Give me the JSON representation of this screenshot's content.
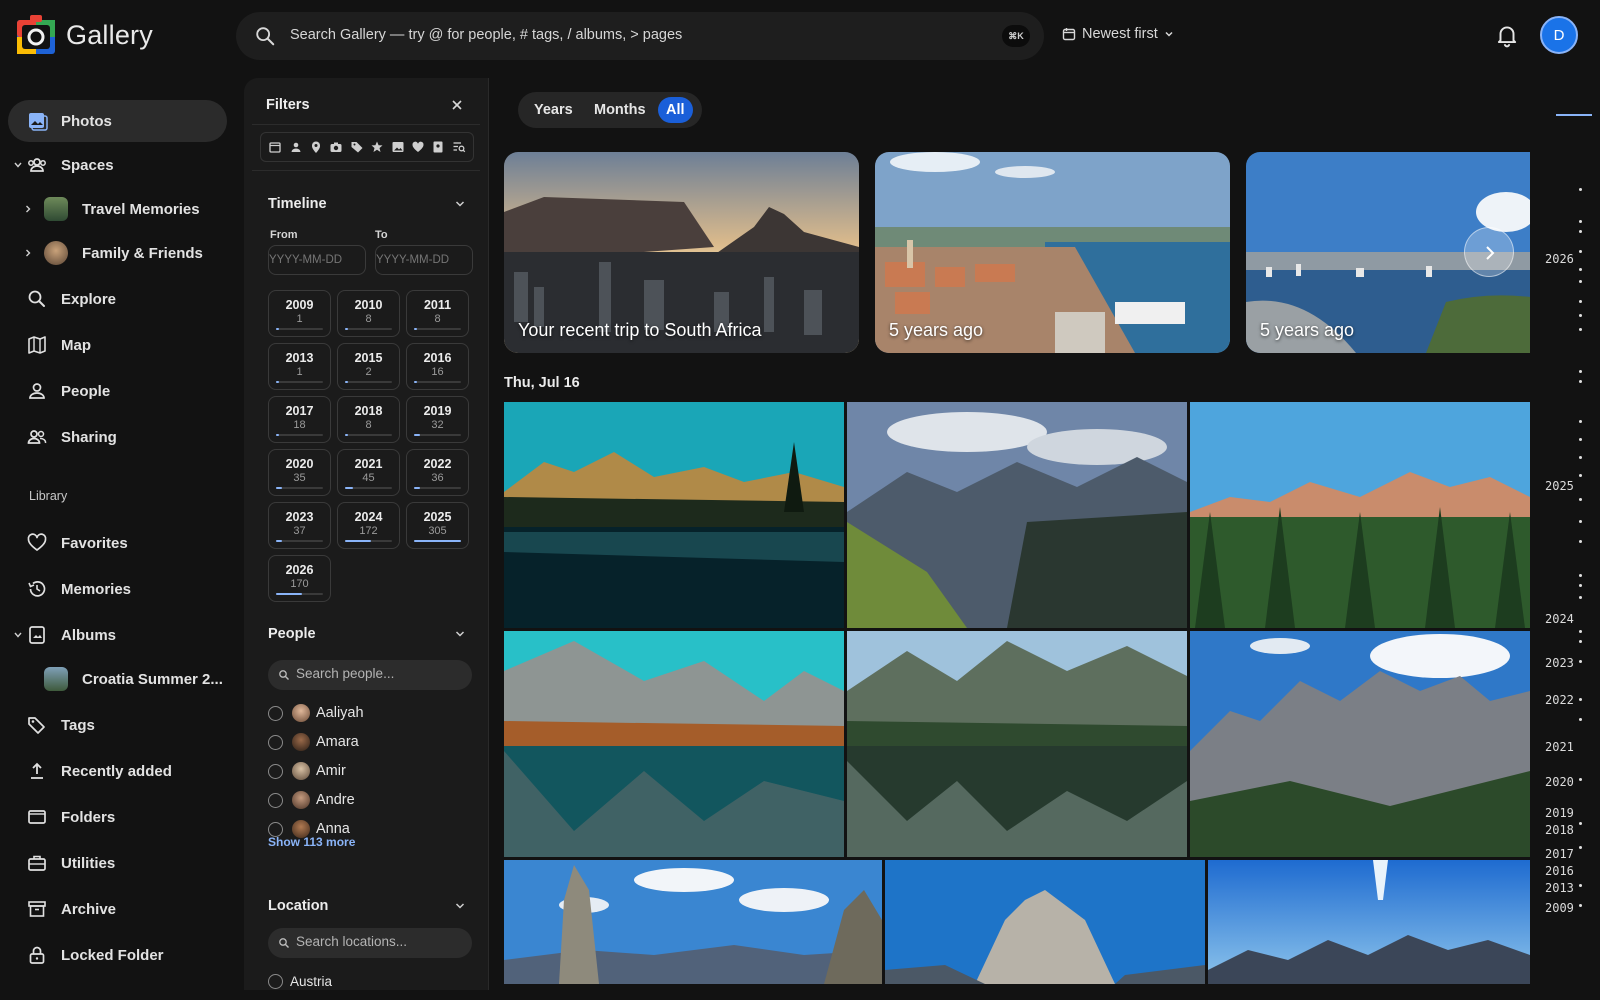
{
  "app": {
    "name": "Gallery"
  },
  "search": {
    "placeholder": "Search Gallery — try @ for people, # tags, / albums, > pages",
    "shortcut": "⌘K"
  },
  "sort": {
    "label": "Newest first"
  },
  "user": {
    "initial": "D"
  },
  "sidebar": {
    "items": [
      {
        "label": "Photos",
        "icon": "photos-icon",
        "active": true
      },
      {
        "label": "Spaces",
        "icon": "spaces-icon"
      },
      {
        "label": "Travel Memories",
        "icon": "album-thumb"
      },
      {
        "label": "Family & Friends",
        "icon": "album-thumb"
      },
      {
        "label": "Explore",
        "icon": "search-icon"
      },
      {
        "label": "Map",
        "icon": "map-icon"
      },
      {
        "label": "People",
        "icon": "person-icon"
      },
      {
        "label": "Sharing",
        "icon": "sharing-icon"
      },
      {
        "label": "Favorites",
        "icon": "heart-icon"
      },
      {
        "label": "Memories",
        "icon": "history-icon"
      },
      {
        "label": "Albums",
        "icon": "albums-icon"
      },
      {
        "label": "Croatia Summer 2...",
        "icon": "album-thumb"
      },
      {
        "label": "Tags",
        "icon": "tag-icon"
      },
      {
        "label": "Recently added",
        "icon": "upload-icon"
      },
      {
        "label": "Folders",
        "icon": "folder-icon"
      },
      {
        "label": "Utilities",
        "icon": "toolbox-icon"
      },
      {
        "label": "Archive",
        "icon": "archive-icon"
      },
      {
        "label": "Locked Folder",
        "icon": "lock-icon"
      }
    ],
    "library_label": "Library"
  },
  "filters": {
    "title": "Filters",
    "timeline": {
      "title": "Timeline",
      "from_label": "From",
      "to_label": "To",
      "date_placeholder": "YYYY-MM-DD",
      "years": [
        {
          "year": "2009",
          "count": "1",
          "fill": 0.02
        },
        {
          "year": "2010",
          "count": "8",
          "fill": 0.05
        },
        {
          "year": "2011",
          "count": "8",
          "fill": 0.05
        },
        {
          "year": "2013",
          "count": "1",
          "fill": 0.02
        },
        {
          "year": "2015",
          "count": "2",
          "fill": 0.03
        },
        {
          "year": "2016",
          "count": "16",
          "fill": 0.07
        },
        {
          "year": "2017",
          "count": "18",
          "fill": 0.07
        },
        {
          "year": "2018",
          "count": "8",
          "fill": 0.05
        },
        {
          "year": "2019",
          "count": "32",
          "fill": 0.12
        },
        {
          "year": "2020",
          "count": "35",
          "fill": 0.13
        },
        {
          "year": "2021",
          "count": "45",
          "fill": 0.16
        },
        {
          "year": "2022",
          "count": "36",
          "fill": 0.13
        },
        {
          "year": "2023",
          "count": "37",
          "fill": 0.13
        },
        {
          "year": "2024",
          "count": "172",
          "fill": 0.56
        },
        {
          "year": "2025",
          "count": "305",
          "fill": 1.0
        },
        {
          "year": "2026",
          "count": "170",
          "fill": 0.55
        }
      ]
    },
    "people": {
      "title": "People",
      "search_placeholder": "Search people...",
      "list": [
        "Aaliyah",
        "Amara",
        "Amir",
        "Andre",
        "Anna"
      ],
      "show_more": "Show 113 more"
    },
    "location": {
      "title": "Location",
      "search_placeholder": "Search locations...",
      "first": "Austria"
    }
  },
  "view_toggle": {
    "options": [
      "Years",
      "Months",
      "All"
    ],
    "active": "All"
  },
  "memories": [
    {
      "label": "Your recent trip to South Africa"
    },
    {
      "label": "5 years ago"
    },
    {
      "label": "5 years ago"
    }
  ],
  "date_group": "Thu, Jul 16",
  "scrubber": {
    "years": [
      "2026",
      "2025",
      "2024",
      "2023",
      "2022",
      "2021",
      "2020",
      "2019",
      "2018",
      "2017",
      "2016",
      "2013",
      "2009"
    ]
  },
  "colors": {
    "accent": "#1a5fd9",
    "link": "#8ab4f8",
    "background": "#121212",
    "panel": "#1b1b1b"
  }
}
